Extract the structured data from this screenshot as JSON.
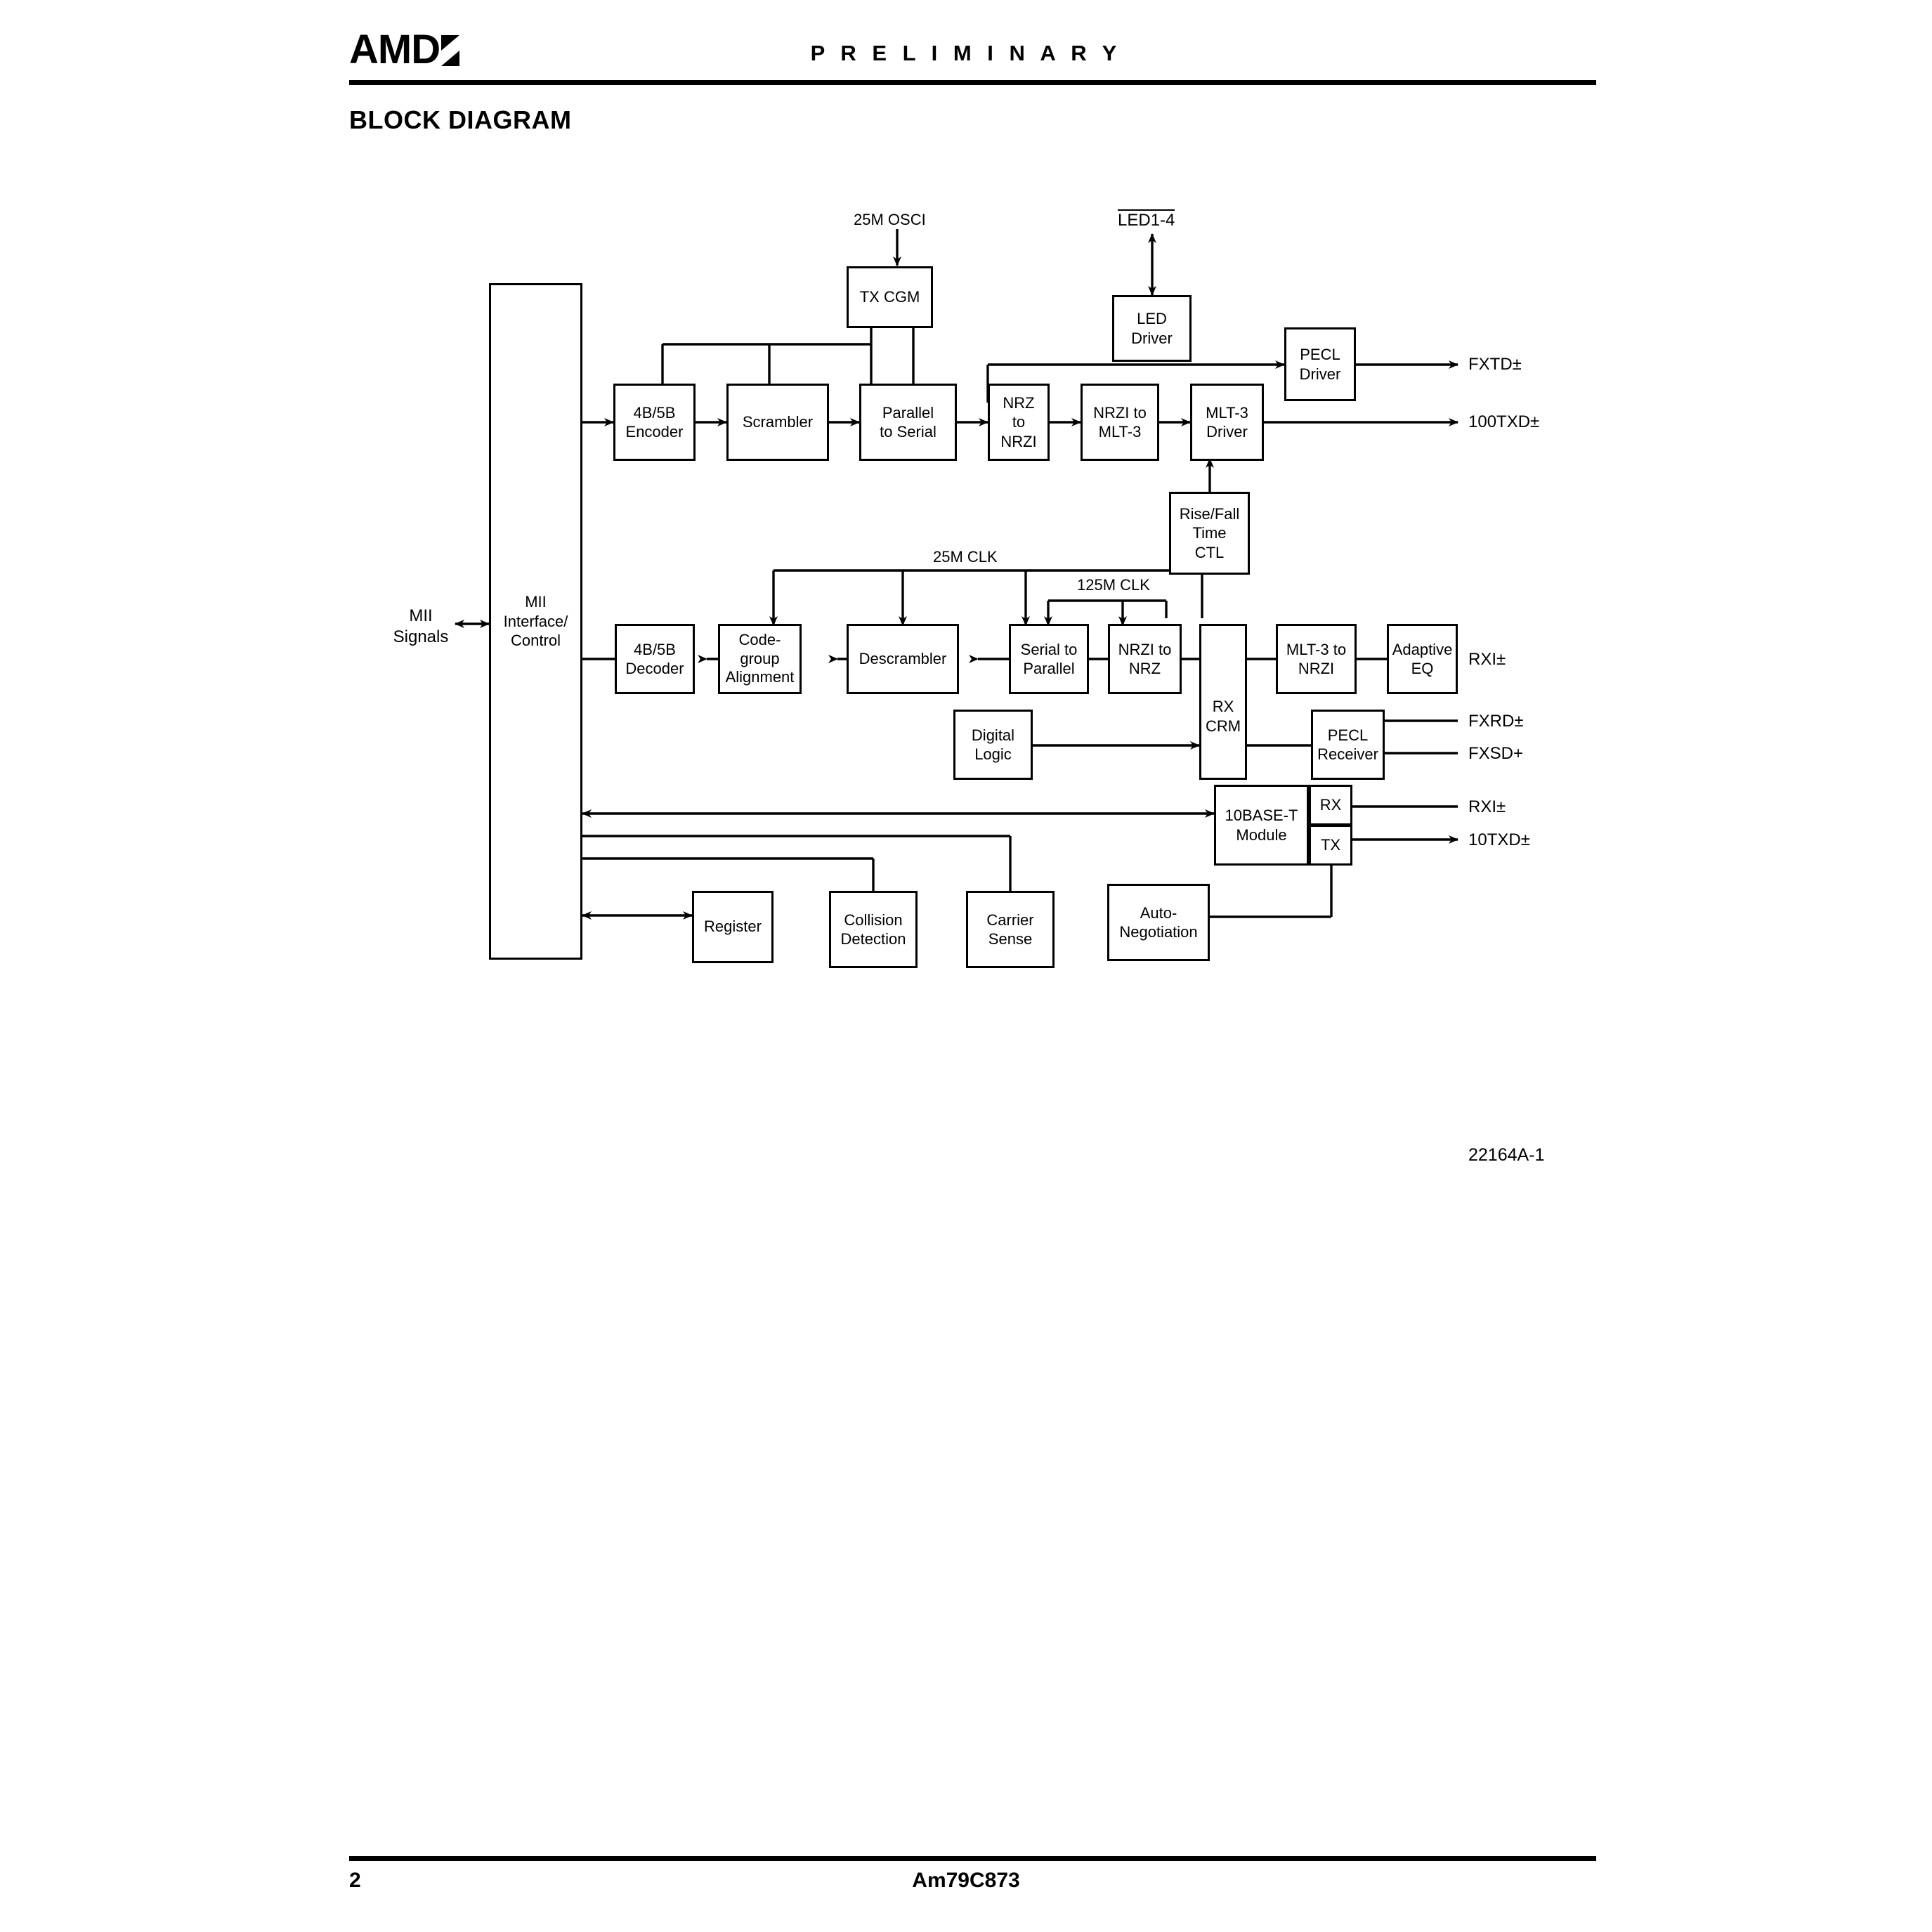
{
  "header": {
    "logo_text": "AMD",
    "logo_icon": "amd-arrow-mark",
    "status": "P R E L I M I N A R Y",
    "section_title": "BLOCK DIAGRAM"
  },
  "footer": {
    "page_number": "2",
    "part_number": "Am79C873",
    "figure_ref": "22164A-1"
  },
  "diagram": {
    "interface": {
      "mii_signals_label": "MII\nSignals",
      "mii_block_label": "MII\nInterface/\nControl"
    },
    "tx_path": [
      {
        "id": "enc45",
        "label": "4B/5B\nEncoder"
      },
      {
        "id": "scrambler",
        "label": "Scrambler"
      },
      {
        "id": "par2ser",
        "label": "Parallel\nto Serial"
      },
      {
        "id": "nrz2nrzi",
        "label": "NRZ\nto\nNRZI"
      },
      {
        "id": "nrzi2mlt3",
        "label": "NRZI to\nMLT-3"
      },
      {
        "id": "mlt3driver",
        "label": "MLT-3\nDriver"
      }
    ],
    "rx_path": [
      {
        "id": "dec45",
        "label": "4B/5B\nDecoder"
      },
      {
        "id": "codegroup",
        "label": "Code-\ngroup\nAlignment"
      },
      {
        "id": "descrambler",
        "label": "Descrambler"
      },
      {
        "id": "ser2par",
        "label": "Serial to\nParallel"
      },
      {
        "id": "nrzi2nrz",
        "label": "NRZI to\nNRZ"
      },
      {
        "id": "rxcrm",
        "label": "RX\nCRM"
      },
      {
        "id": "mlt32nrzi",
        "label": "MLT-3 to\nNRZI"
      },
      {
        "id": "adaptiveeq",
        "label": "Adaptive\nEQ"
      }
    ],
    "support_blocks": [
      {
        "id": "txcgm",
        "label": "TX CGM"
      },
      {
        "id": "leddriver",
        "label": "LED\nDriver"
      },
      {
        "id": "pecldriver",
        "label": "PECL\nDriver"
      },
      {
        "id": "risefall",
        "label": "Rise/Fall\nTime\nCTL"
      },
      {
        "id": "digitallogic",
        "label": "Digital\nLogic"
      },
      {
        "id": "peclrecv",
        "label": "PECL\nReceiver"
      },
      {
        "id": "tenbaset",
        "label": "10BASE-T\nModule"
      },
      {
        "id": "register",
        "label": "Register"
      },
      {
        "id": "collision",
        "label": "Collision\nDetection"
      },
      {
        "id": "carrier",
        "label": "Carrier\nSense"
      },
      {
        "id": "autoneg",
        "label": "Auto-\nNegotiation"
      }
    ],
    "tenbaset_ports": [
      {
        "id": "port_rx",
        "label": "RX"
      },
      {
        "id": "port_tx",
        "label": "TX"
      }
    ],
    "clock_labels": [
      {
        "id": "osci",
        "label": "25M OSCI"
      },
      {
        "id": "clk25",
        "label": "25M CLK"
      },
      {
        "id": "clk125",
        "label": "125M CLK"
      }
    ],
    "io_signals": [
      {
        "id": "led14",
        "label": "LED1-4",
        "overline": true,
        "direction": "bidirectional"
      },
      {
        "id": "fxtd",
        "label": "FXTD±",
        "overline": false,
        "direction": "out"
      },
      {
        "id": "txd100",
        "label": "100TXD±",
        "overline": false,
        "direction": "out"
      },
      {
        "id": "rxi_eq",
        "label": "RXI±",
        "overline": false,
        "direction": "in"
      },
      {
        "id": "fxrd",
        "label": "FXRD±",
        "overline": false,
        "direction": "in"
      },
      {
        "id": "fxsd",
        "label": "FXSD+",
        "overline": false,
        "direction": "in"
      },
      {
        "id": "rxi_10t",
        "label": "RXI±",
        "overline": false,
        "direction": "in"
      },
      {
        "id": "txd10",
        "label": "10TXD±",
        "overline": false,
        "direction": "out"
      }
    ]
  },
  "colors": {
    "ink": "#000000",
    "paper": "#ffffff"
  }
}
